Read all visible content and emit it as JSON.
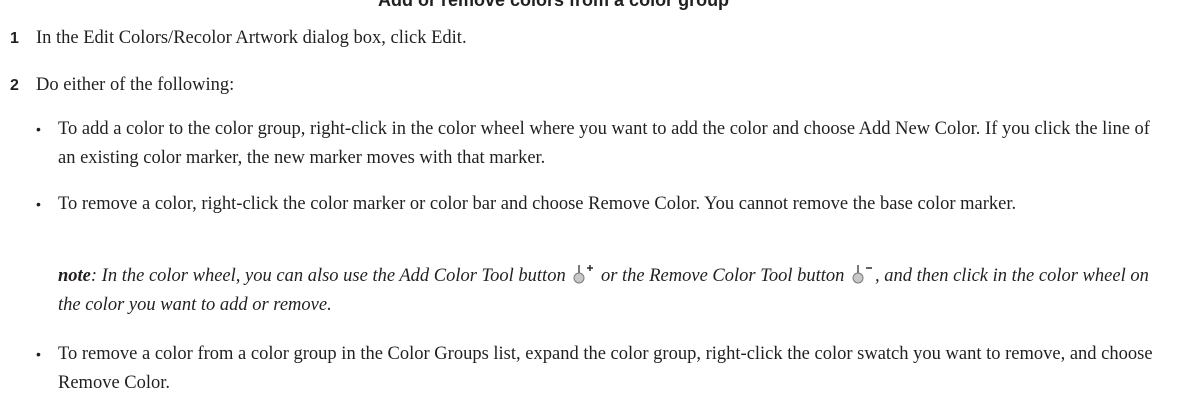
{
  "heading": {
    "partial_text": "Add or remove colors from a color group"
  },
  "steps": [
    {
      "number": "1",
      "text": "In the Edit Colors/Recolor Artwork dialog box, click Edit."
    },
    {
      "number": "2",
      "text": "Do either of the following:"
    }
  ],
  "bullets": [
    {
      "symbol": "•",
      "text": "To add a color to the color group, right-click in the color wheel where you want to add the color and choose Add New Color. If you click the line of an existing color marker, the new marker moves with that marker."
    },
    {
      "symbol": "•",
      "text": "To remove a color, right-click the color marker or color bar and choose Remove Color. You cannot remove the base color marker."
    },
    {
      "symbol": "•",
      "text": "To remove a color from a color group in the Color Groups list, expand the color group, right-click the color swatch you want to remove, and choose Remove Color."
    }
  ],
  "note": {
    "label": "note",
    "text_before_add_icon": ": In the color wheel, you can also use the Add Color Tool button",
    "text_between_icons": "or the Remove Color Tool button",
    "text_after_remove_icon": ", and then click in the color wheel on the color you want to add or remove.",
    "add_icon_name": "add-color-tool-icon",
    "remove_icon_name": "remove-color-tool-icon"
  },
  "colors": {
    "text": "#231f20",
    "background": "#ffffff"
  }
}
